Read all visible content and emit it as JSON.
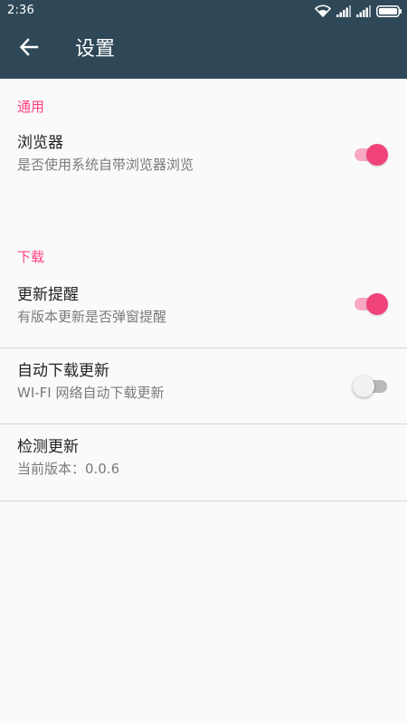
{
  "status_bar": {
    "time": "2:36",
    "icons": [
      "wifi-icon",
      "signal-icon",
      "signal-icon",
      "battery-icon"
    ]
  },
  "app_bar": {
    "back_icon": "arrow-back-icon",
    "title": "设置"
  },
  "colors": {
    "app_bar": "#2f4858",
    "accent": "#ff4081",
    "background": "#fafafa",
    "divider": "#d6d6d6"
  },
  "sections": [
    {
      "header": "通用",
      "items": [
        {
          "title": "浏览器",
          "summary": "是否使用系统自带浏览器浏览",
          "switch": true
        }
      ]
    },
    {
      "header": "下载",
      "items": [
        {
          "title": "更新提醒",
          "summary": "有版本更新是否弹窗提醒",
          "switch": true
        },
        {
          "title": "自动下载更新",
          "summary": "WI-FI 网络自动下载更新",
          "switch": false
        },
        {
          "title": "检测更新",
          "summary": "当前版本：0.0.6"
        }
      ]
    }
  ]
}
